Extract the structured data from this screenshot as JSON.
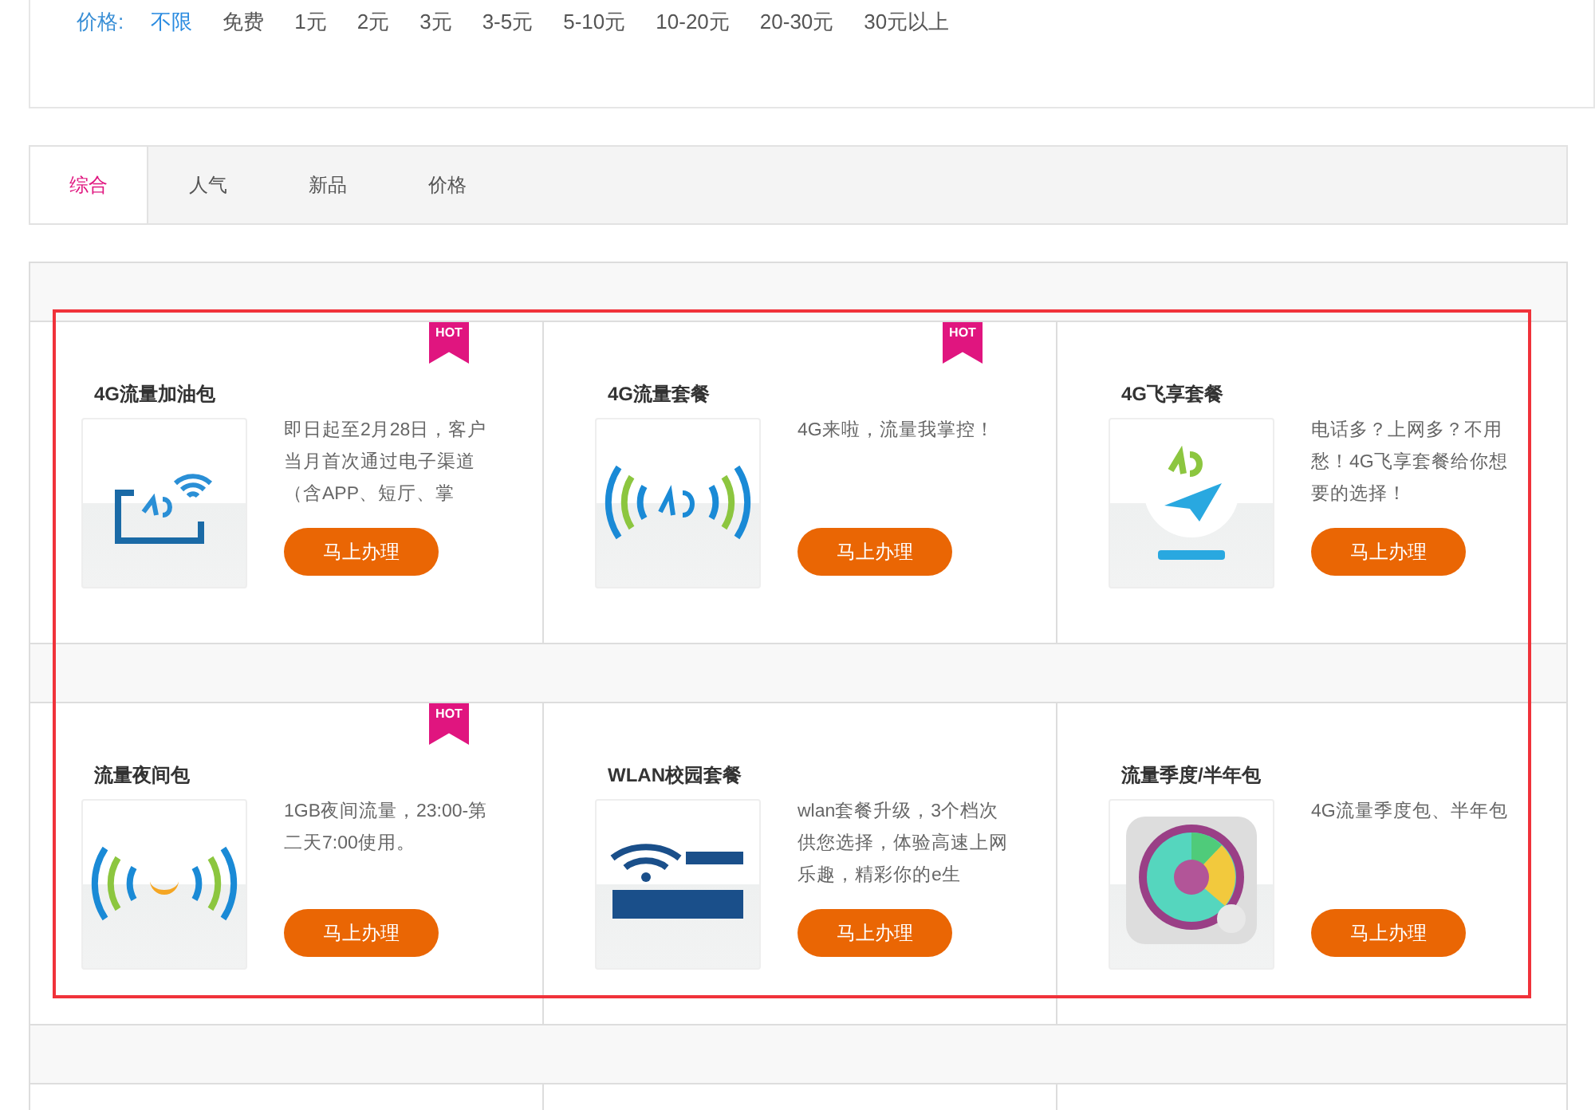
{
  "price_filter": {
    "label": "价格:",
    "options": [
      {
        "label": "不限",
        "selected": true
      },
      {
        "label": "免费",
        "selected": false
      },
      {
        "label": "1元",
        "selected": false
      },
      {
        "label": "2元",
        "selected": false
      },
      {
        "label": "3元",
        "selected": false
      },
      {
        "label": "3-5元",
        "selected": false
      },
      {
        "label": "5-10元",
        "selected": false
      },
      {
        "label": "10-20元",
        "selected": false
      },
      {
        "label": "20-30元",
        "selected": false
      },
      {
        "label": "30元以上",
        "selected": false
      }
    ]
  },
  "sort_tabs": [
    {
      "label": "综合",
      "selected": true
    },
    {
      "label": "人气",
      "selected": false
    },
    {
      "label": "新品",
      "selected": false
    },
    {
      "label": "价格",
      "selected": false
    }
  ],
  "products": [
    {
      "title": "4G流量加油包",
      "description": "即日起至2月28日，客户当月首次通过电子渠道（含APP、短厅、掌",
      "badge": "HOT",
      "kind": "tablet",
      "button": "马上办理"
    },
    {
      "title": "4G流量套餐",
      "description": "4G来啦，流量我掌控！",
      "badge": "HOT",
      "kind": "signal",
      "button": "马上办理"
    },
    {
      "title": "4G飞享套餐",
      "description": "电话多？上网多？不用愁！4G飞享套餐给你想要的选择！",
      "kind": "plane",
      "button": "马上办理"
    },
    {
      "title": "流量夜间包",
      "description": "1GB夜间流量，23:00-第二天7:00使用。",
      "badge": "HOT",
      "kind": "moon",
      "button": "马上办理"
    },
    {
      "title": "WLAN校园套餐",
      "description": "wlan套餐升级，3个档次供您选择，体验高速上网乐趣，精彩你的e生",
      "kind": "wifi",
      "button": "马上办理"
    },
    {
      "title": "流量季度/半年包",
      "description": "4G流量季度包、半年包",
      "kind": "donut",
      "button": "马上办理"
    }
  ]
}
